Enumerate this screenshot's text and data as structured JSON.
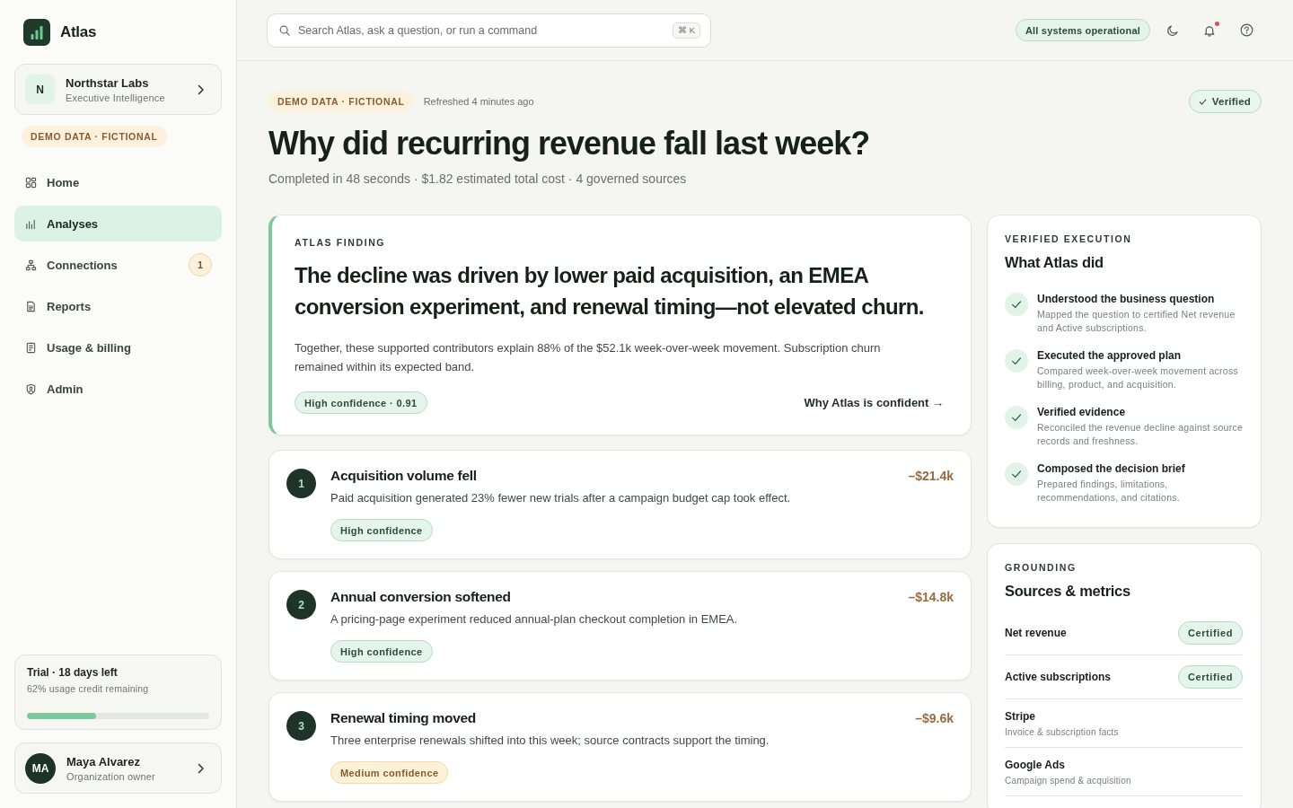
{
  "sidebar": {
    "brand": "Atlas",
    "workspace": {
      "initial": "N",
      "name": "Northstar Labs",
      "subtitle": "Executive Intelligence"
    },
    "demo_badge": "DEMO DATA · FICTIONAL",
    "nav": [
      {
        "label": "Home",
        "selected": false
      },
      {
        "label": "Analyses",
        "selected": true
      },
      {
        "label": "Connections",
        "selected": false,
        "badge": "1"
      },
      {
        "label": "Reports",
        "selected": false
      },
      {
        "label": "Usage & billing",
        "selected": false
      },
      {
        "label": "Admin",
        "selected": false
      }
    ],
    "trial": {
      "title": "Trial · 18 days left",
      "detail": "62% usage credit remaining",
      "level": 0.38
    },
    "user": {
      "initials": "MA",
      "name": "Maya Alvarez",
      "role": "Organization owner"
    }
  },
  "topbar": {
    "search": {
      "placeholder": "Search Atlas, ask a question, or run a command",
      "shortcut": "⌘ K"
    },
    "status": "All systems operational",
    "notifications": {
      "unread": true
    }
  },
  "header": {
    "demo_badge": "DEMO DATA · FICTIONAL",
    "refreshed": "Refreshed 4 minutes ago",
    "verified": "Verified",
    "title": "Why did recurring revenue fall last week?",
    "meta": "Completed in 48 seconds · $1.82 estimated total cost · 4 governed sources"
  },
  "finding": {
    "eyebrow": "ATLAS FINDING",
    "headline": "The decline was driven by lower paid acquisition, an EMEA conversion experiment, and renewal timing—not elevated churn.",
    "summary": "Together, these supported contributors explain 88% of the $52.1k week-over-week movement. Subscription churn remained within its expected band.",
    "confidence": {
      "label": "High confidence · 0.91",
      "kind": "high"
    },
    "link": "Why Atlas is confident →"
  },
  "causes": [
    {
      "number": "1",
      "title": "Acquisition volume fell",
      "description": "Paid acquisition generated 23% fewer new trials after a campaign budget cap took effect.",
      "amount": "–$21.4k",
      "confidence": {
        "label": "High confidence",
        "kind": "high"
      }
    },
    {
      "number": "2",
      "title": "Annual conversion softened",
      "description": "A pricing-page experiment reduced annual-plan checkout completion in EMEA.",
      "amount": "–$14.8k",
      "confidence": {
        "label": "High confidence",
        "kind": "high"
      }
    },
    {
      "number": "3",
      "title": "Renewal timing moved",
      "description": "Three enterprise renewals shifted into this week; source contracts support the timing.",
      "amount": "–$9.6k",
      "confidence": {
        "label": "Medium confidence",
        "kind": "medium"
      }
    }
  ],
  "execution": {
    "eyebrow": "VERIFIED EXECUTION",
    "title": "What Atlas did",
    "steps": [
      {
        "title": "Understood the business question",
        "detail": "Mapped the question to certified Net revenue and Active subscriptions.",
        "done": true
      },
      {
        "title": "Executed the approved plan",
        "detail": "Compared week-over-week movement across billing, product, and acquisition.",
        "done": true
      },
      {
        "title": "Verified evidence",
        "detail": "Reconciled the revenue decline against source records and freshness.",
        "done": true
      },
      {
        "title": "Composed the decision brief",
        "detail": "Prepared findings, limitations, recommendations, and citations.",
        "done": true
      }
    ]
  },
  "grounding": {
    "eyebrow": "GROUNDING",
    "title": "Sources & metrics",
    "items": [
      {
        "kind": "metric",
        "name": "Net revenue",
        "badge": "Certified"
      },
      {
        "kind": "metric",
        "name": "Active subscriptions",
        "badge": "Certified"
      },
      {
        "kind": "source",
        "name": "Stripe",
        "detail": "Invoice & subscription facts"
      },
      {
        "kind": "source",
        "name": "Google Ads",
        "detail": "Campaign spend & acquisition"
      }
    ]
  }
}
